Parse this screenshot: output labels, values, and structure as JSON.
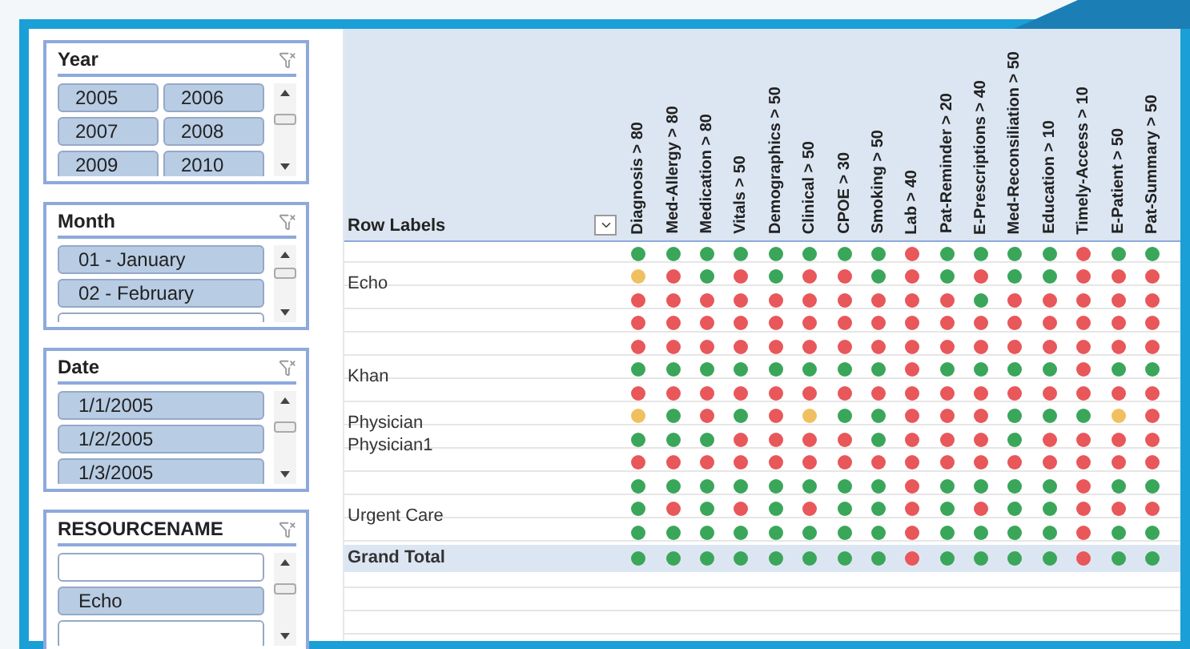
{
  "slicers": [
    {
      "title": "Year",
      "kind": "grid",
      "items": [
        {
          "kind": "value",
          "label": "2005"
        },
        {
          "kind": "value",
          "label": "2006"
        },
        {
          "kind": "value",
          "label": "2007"
        },
        {
          "kind": "value",
          "label": "2008"
        },
        {
          "kind": "value",
          "label": "2009"
        },
        {
          "kind": "value",
          "label": "2010"
        }
      ]
    },
    {
      "title": "Month",
      "kind": "list",
      "items": [
        {
          "kind": "value",
          "label": "01 - January"
        },
        {
          "kind": "value",
          "label": "02 - February"
        },
        {
          "kind": "blank"
        }
      ]
    },
    {
      "title": "Date",
      "kind": "list",
      "items": [
        {
          "kind": "value",
          "label": "1/1/2005"
        },
        {
          "kind": "value",
          "label": "1/2/2005"
        },
        {
          "kind": "value",
          "label": "1/3/2005"
        }
      ]
    },
    {
      "title": "RESOURCENAME",
      "kind": "list",
      "items": [
        {
          "kind": "blank"
        },
        {
          "kind": "value",
          "label": "Echo"
        },
        {
          "kind": "blank"
        }
      ]
    }
  ],
  "pivot": {
    "row_labels_header": "Row Labels",
    "columns": [
      "Diagnosis > 80",
      "Med-Allergy > 80",
      "Medication > 80",
      "Vitals > 50",
      "Demographics > 50",
      "Clinical > 50",
      "CPOE > 30",
      "Smoking > 50",
      "Lab > 40",
      "Pat-Reminder > 20",
      "E-Prescriptions > 40",
      "Med-Reconsiliation > 50",
      "Education > 10",
      "Timely-Access > 10",
      "E-Patient > 50",
      "Pat-Summary > 50"
    ],
    "rows": [
      {
        "kind": "data",
        "dots": [
          {
            "color": "#3aa65a"
          },
          {
            "color": "#3aa65a"
          },
          {
            "color": "#3aa65a"
          },
          {
            "color": "#3aa65a"
          },
          {
            "color": "#3aa65a"
          },
          {
            "color": "#3aa65a"
          },
          {
            "color": "#3aa65a"
          },
          {
            "color": "#3aa65a"
          },
          {
            "color": "#e8575a"
          },
          {
            "color": "#3aa65a"
          },
          {
            "color": "#3aa65a"
          },
          {
            "color": "#3aa65a"
          },
          {
            "color": "#3aa65a"
          },
          {
            "color": "#e8575a"
          },
          {
            "color": "#3aa65a"
          },
          {
            "color": "#3aa65a"
          }
        ]
      },
      {
        "kind": "data",
        "label": "Echo",
        "dots": [
          {
            "color": "#f0c060"
          },
          {
            "color": "#e8575a"
          },
          {
            "color": "#3aa65a"
          },
          {
            "color": "#e8575a"
          },
          {
            "color": "#3aa65a"
          },
          {
            "color": "#e8575a"
          },
          {
            "color": "#e8575a"
          },
          {
            "color": "#3aa65a"
          },
          {
            "color": "#e8575a"
          },
          {
            "color": "#3aa65a"
          },
          {
            "color": "#e8575a"
          },
          {
            "color": "#3aa65a"
          },
          {
            "color": "#3aa65a"
          },
          {
            "color": "#e8575a"
          },
          {
            "color": "#e8575a"
          },
          {
            "color": "#e8575a"
          }
        ]
      },
      {
        "kind": "data",
        "dots": [
          {
            "color": "#e8575a"
          },
          {
            "color": "#e8575a"
          },
          {
            "color": "#e8575a"
          },
          {
            "color": "#e8575a"
          },
          {
            "color": "#e8575a"
          },
          {
            "color": "#e8575a"
          },
          {
            "color": "#e8575a"
          },
          {
            "color": "#e8575a"
          },
          {
            "color": "#e8575a"
          },
          {
            "color": "#e8575a"
          },
          {
            "color": "#3aa65a"
          },
          {
            "color": "#e8575a"
          },
          {
            "color": "#e8575a"
          },
          {
            "color": "#e8575a"
          },
          {
            "color": "#e8575a"
          },
          {
            "color": "#e8575a"
          }
        ]
      },
      {
        "kind": "data",
        "dots": [
          {
            "color": "#e8575a"
          },
          {
            "color": "#e8575a"
          },
          {
            "color": "#e8575a"
          },
          {
            "color": "#e8575a"
          },
          {
            "color": "#e8575a"
          },
          {
            "color": "#e8575a"
          },
          {
            "color": "#e8575a"
          },
          {
            "color": "#e8575a"
          },
          {
            "color": "#e8575a"
          },
          {
            "color": "#e8575a"
          },
          {
            "color": "#e8575a"
          },
          {
            "color": "#e8575a"
          },
          {
            "color": "#e8575a"
          },
          {
            "color": "#e8575a"
          },
          {
            "color": "#e8575a"
          },
          {
            "color": "#e8575a"
          }
        ]
      },
      {
        "kind": "data",
        "dots": [
          {
            "color": "#e8575a"
          },
          {
            "color": "#e8575a"
          },
          {
            "color": "#e8575a"
          },
          {
            "color": "#e8575a"
          },
          {
            "color": "#e8575a"
          },
          {
            "color": "#e8575a"
          },
          {
            "color": "#e8575a"
          },
          {
            "color": "#e8575a"
          },
          {
            "color": "#e8575a"
          },
          {
            "color": "#e8575a"
          },
          {
            "color": "#e8575a"
          },
          {
            "color": "#e8575a"
          },
          {
            "color": "#e8575a"
          },
          {
            "color": "#e8575a"
          },
          {
            "color": "#e8575a"
          },
          {
            "color": "#e8575a"
          }
        ]
      },
      {
        "kind": "data",
        "label": "Khan",
        "dots": [
          {
            "color": "#3aa65a"
          },
          {
            "color": "#3aa65a"
          },
          {
            "color": "#3aa65a"
          },
          {
            "color": "#3aa65a"
          },
          {
            "color": "#3aa65a"
          },
          {
            "color": "#3aa65a"
          },
          {
            "color": "#3aa65a"
          },
          {
            "color": "#3aa65a"
          },
          {
            "color": "#e8575a"
          },
          {
            "color": "#3aa65a"
          },
          {
            "color": "#3aa65a"
          },
          {
            "color": "#3aa65a"
          },
          {
            "color": "#3aa65a"
          },
          {
            "color": "#e8575a"
          },
          {
            "color": "#3aa65a"
          },
          {
            "color": "#3aa65a"
          }
        ]
      },
      {
        "kind": "data",
        "dots": [
          {
            "color": "#e8575a"
          },
          {
            "color": "#e8575a"
          },
          {
            "color": "#e8575a"
          },
          {
            "color": "#e8575a"
          },
          {
            "color": "#e8575a"
          },
          {
            "color": "#e8575a"
          },
          {
            "color": "#e8575a"
          },
          {
            "color": "#e8575a"
          },
          {
            "color": "#e8575a"
          },
          {
            "color": "#e8575a"
          },
          {
            "color": "#e8575a"
          },
          {
            "color": "#e8575a"
          },
          {
            "color": "#e8575a"
          },
          {
            "color": "#e8575a"
          },
          {
            "color": "#e8575a"
          },
          {
            "color": "#e8575a"
          }
        ]
      },
      {
        "kind": "data",
        "label": "Physician",
        "dots": [
          {
            "color": "#f0c060"
          },
          {
            "color": "#3aa65a"
          },
          {
            "color": "#e8575a"
          },
          {
            "color": "#3aa65a"
          },
          {
            "color": "#e8575a"
          },
          {
            "color": "#f0c060"
          },
          {
            "color": "#3aa65a"
          },
          {
            "color": "#3aa65a"
          },
          {
            "color": "#e8575a"
          },
          {
            "color": "#e8575a"
          },
          {
            "color": "#e8575a"
          },
          {
            "color": "#3aa65a"
          },
          {
            "color": "#3aa65a"
          },
          {
            "color": "#3aa65a"
          },
          {
            "color": "#f0c060"
          },
          {
            "color": "#e8575a"
          }
        ]
      },
      {
        "kind": "data",
        "label": "Physician1",
        "dots": [
          {
            "color": "#3aa65a"
          },
          {
            "color": "#3aa65a"
          },
          {
            "color": "#3aa65a"
          },
          {
            "color": "#e8575a"
          },
          {
            "color": "#e8575a"
          },
          {
            "color": "#e8575a"
          },
          {
            "color": "#e8575a"
          },
          {
            "color": "#3aa65a"
          },
          {
            "color": "#e8575a"
          },
          {
            "color": "#e8575a"
          },
          {
            "color": "#e8575a"
          },
          {
            "color": "#3aa65a"
          },
          {
            "color": "#e8575a"
          },
          {
            "color": "#e8575a"
          },
          {
            "color": "#e8575a"
          },
          {
            "color": "#e8575a"
          }
        ]
      },
      {
        "kind": "data",
        "dots": [
          {
            "color": "#e8575a"
          },
          {
            "color": "#e8575a"
          },
          {
            "color": "#e8575a"
          },
          {
            "color": "#e8575a"
          },
          {
            "color": "#e8575a"
          },
          {
            "color": "#e8575a"
          },
          {
            "color": "#e8575a"
          },
          {
            "color": "#e8575a"
          },
          {
            "color": "#e8575a"
          },
          {
            "color": "#e8575a"
          },
          {
            "color": "#e8575a"
          },
          {
            "color": "#e8575a"
          },
          {
            "color": "#e8575a"
          },
          {
            "color": "#e8575a"
          },
          {
            "color": "#e8575a"
          },
          {
            "color": "#e8575a"
          }
        ]
      },
      {
        "kind": "data",
        "dots": [
          {
            "color": "#3aa65a"
          },
          {
            "color": "#3aa65a"
          },
          {
            "color": "#3aa65a"
          },
          {
            "color": "#3aa65a"
          },
          {
            "color": "#3aa65a"
          },
          {
            "color": "#3aa65a"
          },
          {
            "color": "#3aa65a"
          },
          {
            "color": "#3aa65a"
          },
          {
            "color": "#e8575a"
          },
          {
            "color": "#3aa65a"
          },
          {
            "color": "#3aa65a"
          },
          {
            "color": "#3aa65a"
          },
          {
            "color": "#3aa65a"
          },
          {
            "color": "#e8575a"
          },
          {
            "color": "#3aa65a"
          },
          {
            "color": "#3aa65a"
          }
        ]
      },
      {
        "kind": "data",
        "label": "Urgent Care",
        "dots": [
          {
            "color": "#3aa65a"
          },
          {
            "color": "#e8575a"
          },
          {
            "color": "#3aa65a"
          },
          {
            "color": "#e8575a"
          },
          {
            "color": "#3aa65a"
          },
          {
            "color": "#e8575a"
          },
          {
            "color": "#3aa65a"
          },
          {
            "color": "#3aa65a"
          },
          {
            "color": "#e8575a"
          },
          {
            "color": "#3aa65a"
          },
          {
            "color": "#e8575a"
          },
          {
            "color": "#3aa65a"
          },
          {
            "color": "#3aa65a"
          },
          {
            "color": "#e8575a"
          },
          {
            "color": "#e8575a"
          },
          {
            "color": "#e8575a"
          }
        ]
      },
      {
        "kind": "data",
        "dots": [
          {
            "color": "#3aa65a"
          },
          {
            "color": "#3aa65a"
          },
          {
            "color": "#3aa65a"
          },
          {
            "color": "#3aa65a"
          },
          {
            "color": "#3aa65a"
          },
          {
            "color": "#3aa65a"
          },
          {
            "color": "#3aa65a"
          },
          {
            "color": "#3aa65a"
          },
          {
            "color": "#e8575a"
          },
          {
            "color": "#3aa65a"
          },
          {
            "color": "#3aa65a"
          },
          {
            "color": "#3aa65a"
          },
          {
            "color": "#3aa65a"
          },
          {
            "color": "#e8575a"
          },
          {
            "color": "#3aa65a"
          },
          {
            "color": "#3aa65a"
          }
        ]
      },
      {
        "kind": "total",
        "label": "Grand Total",
        "dots": [
          {
            "color": "#3aa65a"
          },
          {
            "color": "#3aa65a"
          },
          {
            "color": "#3aa65a"
          },
          {
            "color": "#3aa65a"
          },
          {
            "color": "#3aa65a"
          },
          {
            "color": "#3aa65a"
          },
          {
            "color": "#3aa65a"
          },
          {
            "color": "#3aa65a"
          },
          {
            "color": "#e8575a"
          },
          {
            "color": "#3aa65a"
          },
          {
            "color": "#3aa65a"
          },
          {
            "color": "#3aa65a"
          },
          {
            "color": "#3aa65a"
          },
          {
            "color": "#e8575a"
          },
          {
            "color": "#3aa65a"
          },
          {
            "color": "#3aa65a"
          }
        ]
      }
    ]
  }
}
